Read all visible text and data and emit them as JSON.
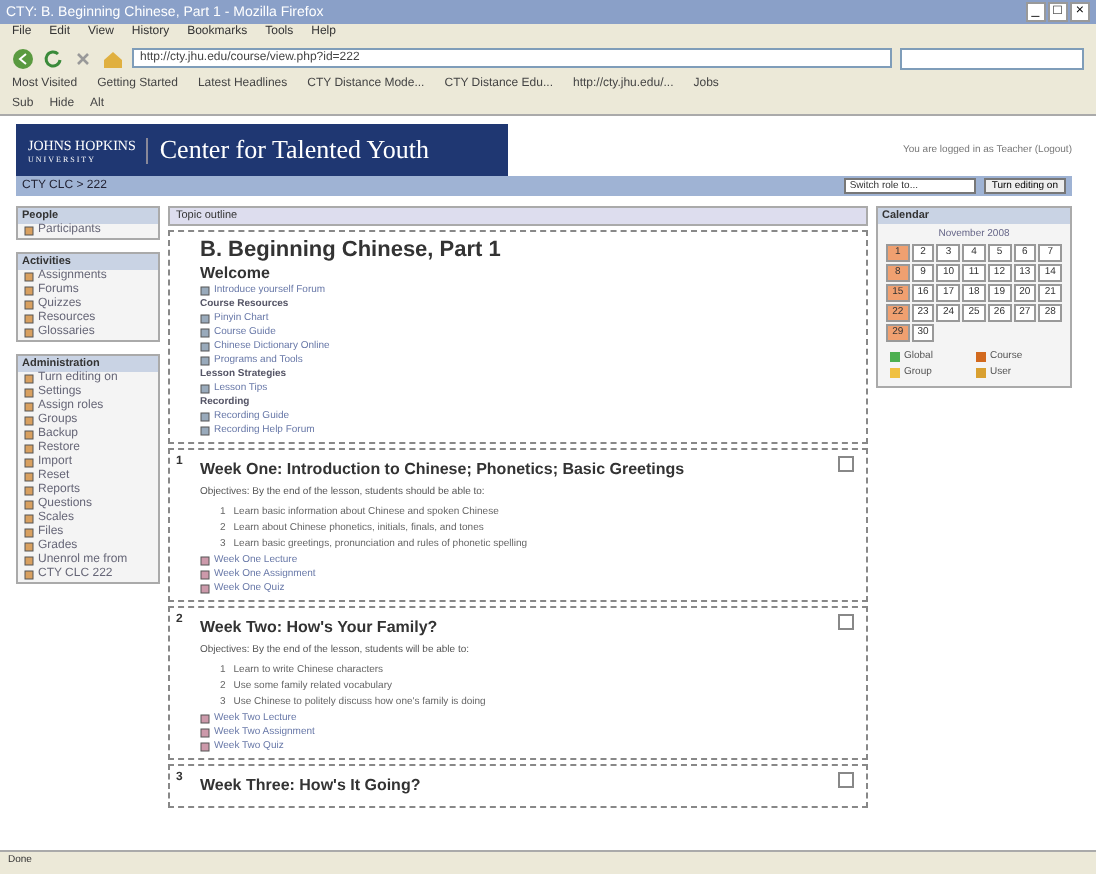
{
  "window": {
    "title": "CTY: B. Beginning Chinese, Part 1 - Mozilla Firefox",
    "controls": [
      "_",
      "□",
      "×"
    ]
  },
  "menu": [
    "File",
    "Edit",
    "View",
    "History",
    "Bookmarks",
    "Tools",
    "Help"
  ],
  "address": {
    "value": "http://cty.jhu.edu/course/view.php?id=222"
  },
  "bookmarks": [
    "Most Visited",
    "Getting Started",
    "Latest Headlines",
    "CTY Distance Mode...",
    "CTY Distance Edu...",
    "http://cty.jhu.edu/...",
    "Jobs"
  ],
  "toolbar2": [
    "Sub",
    "Hide",
    "Alt"
  ],
  "banner": {
    "logo_top": "JOHNS HOPKINS",
    "logo_bottom": "UNIVERSITY",
    "title": "Center for Talented Youth",
    "login": "You are logged in as Teacher (Logout)"
  },
  "navbar": {
    "breadcrumb": "CTY CLC > 222",
    "role": "Switch role to...",
    "edit_button": "Turn editing on"
  },
  "left_blocks": [
    {
      "title": "People",
      "items": [
        "Participants"
      ]
    },
    {
      "title": "Activities",
      "items": [
        "Assignments",
        "Forums",
        "Quizzes",
        "Resources",
        "Glossaries"
      ]
    },
    {
      "title": "Administration",
      "items": [
        "Turn editing on",
        "Settings",
        "Assign roles",
        "Groups",
        "Backup",
        "Restore",
        "Import",
        "Reset",
        "Reports",
        "Questions",
        "Scales",
        "Files",
        "Grades",
        "Unenrol me from",
        "CTY CLC 222"
      ]
    }
  ],
  "outline_title": "Topic outline",
  "intro": {
    "title": "B. Beginning Chinese, Part 1",
    "subtitle": "Welcome",
    "links": [
      {
        "kind": "link",
        "text": "Introduce yourself Forum"
      },
      {
        "kind": "heading",
        "text": "Course Resources"
      },
      {
        "kind": "link",
        "text": "Pinyin Chart"
      },
      {
        "kind": "link",
        "text": "Course Guide"
      },
      {
        "kind": "link",
        "text": "Chinese Dictionary Online"
      },
      {
        "kind": "link",
        "text": "Programs and Tools"
      },
      {
        "kind": "heading",
        "text": "Lesson Strategies"
      },
      {
        "kind": "link",
        "text": "Lesson Tips"
      },
      {
        "kind": "heading",
        "text": "Recording"
      },
      {
        "kind": "link",
        "text": "Recording Guide"
      },
      {
        "kind": "link",
        "text": "Recording Help Forum"
      }
    ]
  },
  "weeks": [
    {
      "number": "1",
      "title": "Week One: Introduction to Chinese; Phonetics; Basic Greetings",
      "objectives": "Objectives: By the end of the lesson, students should be able to:",
      "points": [
        {
          "number": "1",
          "text": "Learn basic information about Chinese and spoken Chinese"
        },
        {
          "number": "2",
          "text": "Learn about Chinese phonetics, initials, finals, and tones"
        },
        {
          "number": "3",
          "text": "Learn basic greetings, pronunciation and rules of phonetic spelling"
        }
      ],
      "links": [
        "Week One Lecture",
        "Week One Assignment",
        "Week One Quiz"
      ]
    },
    {
      "number": "2",
      "title": "Week Two: How's Your Family?",
      "objectives": "Objectives: By the end of the lesson, students will be able to:",
      "points": [
        {
          "number": "1",
          "text": "Learn to write Chinese characters"
        },
        {
          "number": "2",
          "text": "Use some family related vocabulary"
        },
        {
          "number": "3",
          "text": "Use Chinese to politely discuss how one's family is doing"
        }
      ],
      "links": [
        "Week Two Lecture",
        "Week Two Assignment",
        "Week Two Quiz"
      ]
    },
    {
      "number": "3",
      "title": "Week Three: How's It Going?"
    }
  ],
  "calendar": {
    "title": "Calendar",
    "month": "November 2008",
    "days": [
      "1",
      "2",
      "3",
      "4",
      "5",
      "6",
      "7",
      "8",
      "9",
      "10",
      "11",
      "12",
      "13",
      "14",
      "15",
      "16",
      "17",
      "18",
      "19",
      "20",
      "21",
      "22",
      "23",
      "24",
      "25",
      "26",
      "27",
      "28",
      "29",
      "30"
    ],
    "legend": [
      {
        "label": "Global",
        "color": "#4caf50"
      },
      {
        "label": "Course",
        "color": "#d2691e"
      },
      {
        "label": "Group",
        "color": "#f0c040"
      },
      {
        "label": "User",
        "color": "#d9a030"
      }
    ]
  },
  "status": "Done"
}
